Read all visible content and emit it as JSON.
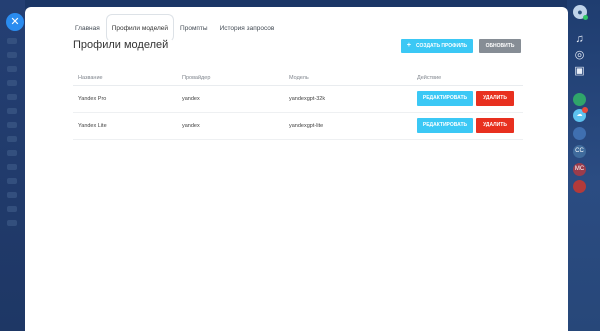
{
  "tabs": [
    {
      "label": "Главная",
      "active": false
    },
    {
      "label": "Профили моделей",
      "active": true
    },
    {
      "label": "Промпты",
      "active": false
    },
    {
      "label": "История запросов",
      "active": false
    }
  ],
  "page_title": "Профили моделей",
  "toolbar": {
    "create_label": "Создать профиль",
    "create_icon": "+",
    "refresh_label": "Обновить"
  },
  "table": {
    "headers": [
      "Название",
      "Провайдер",
      "Модель",
      "Действие"
    ],
    "rows": [
      {
        "name": "Yandex Pro",
        "provider": "yandex",
        "model": "yandexgpt-32k",
        "edit": "Редактировать",
        "delete": "Удалить"
      },
      {
        "name": "Yandex Lite",
        "provider": "yandex",
        "model": "yandexgpt-lite",
        "edit": "Редактировать",
        "delete": "Удалить"
      }
    ]
  },
  "overlay": {
    "close_glyph": "✕"
  },
  "right_panel": {
    "icons": [
      {
        "name": "bell-icon",
        "glyph": "🔔"
      },
      {
        "name": "copilot-icon",
        "glyph": "◎"
      },
      {
        "name": "calendar-icon",
        "glyph": "▣"
      },
      {
        "name": "chat-icon",
        "glyph": "●"
      },
      {
        "name": "cloud-icon",
        "glyph": "☁"
      },
      {
        "name": "group-icon",
        "glyph": "●"
      },
      {
        "name": "contact-cc-icon",
        "glyph": "CC"
      },
      {
        "name": "contact-mc-icon",
        "glyph": "MC"
      },
      {
        "name": "contact-red-icon",
        "glyph": "●"
      }
    ]
  },
  "colors": {
    "accent": "#3bc8f5",
    "danger": "#e8301f",
    "neutral": "#868d95",
    "background": "#1b3666"
  }
}
